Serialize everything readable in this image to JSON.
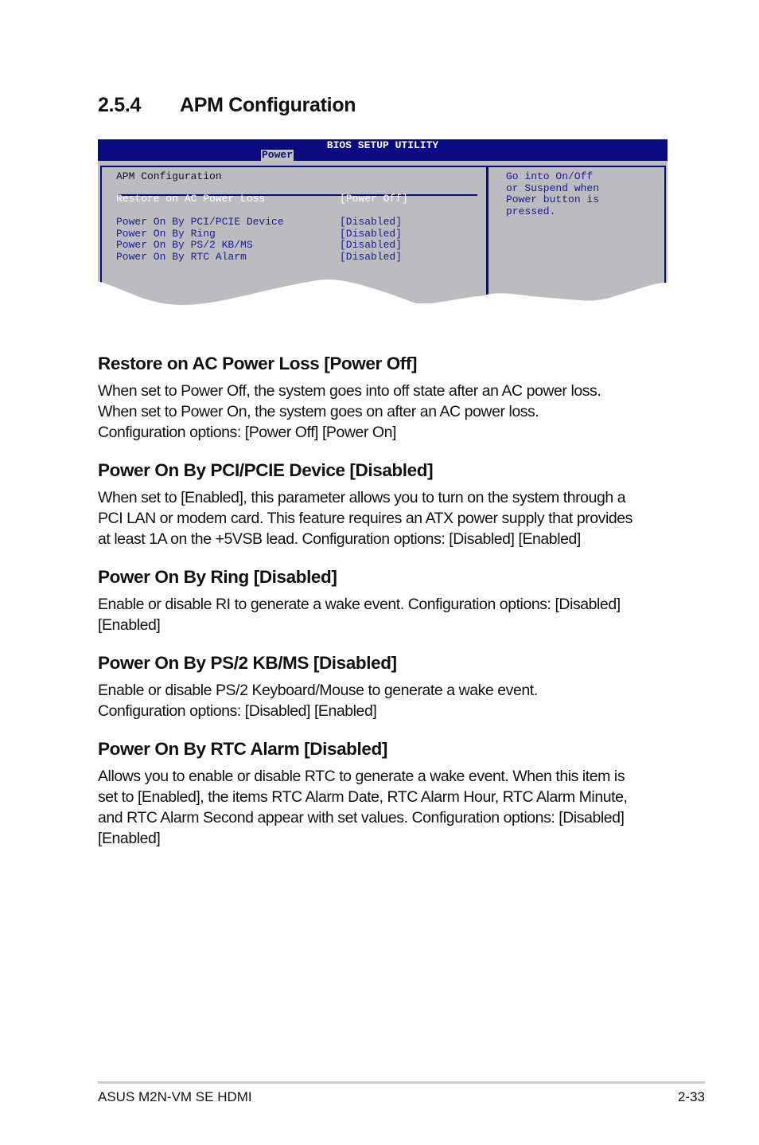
{
  "section": {
    "number": "2.5.4",
    "title": "APM Configuration"
  },
  "bios": {
    "title": "BIOS SETUP UTILITY",
    "tab": "Power",
    "panel_title": "APM Configuration",
    "items": [
      {
        "label": "Restore on AC Power Loss",
        "value": "[Power Off]",
        "selected": true
      },
      {
        "label": "Power On By PCI/PCIE Device",
        "value": "[Disabled]"
      },
      {
        "label": "Power On By Ring",
        "value": "[Disabled]"
      },
      {
        "label": "Power On By PS/2 KB/MS",
        "value": "[Disabled]"
      },
      {
        "label": "Power On By RTC Alarm",
        "value": "[Disabled]"
      }
    ],
    "help": [
      "Go into On/Off",
      "or Suspend when",
      "Power button is",
      "pressed."
    ],
    "colors": {
      "bar": "#0a0a80",
      "panel": "#bcbcc0",
      "selected_text": "#ffffff"
    }
  },
  "sections": [
    {
      "heading": "Restore on AC Power Loss [Power Off]",
      "lines": [
        "When set to Power Off, the system goes into off state after an AC power loss.",
        "When set to Power On, the system goes on after an AC power loss.",
        "Configuration options: [Power Off] [Power On]"
      ]
    },
    {
      "heading": "Power On By PCI/PCIE Device [Disabled]",
      "lines": [
        "When set to [Enabled], this parameter allows you to turn on the system through a",
        "PCI LAN or modem card. This feature requires an ATX power supply that provides",
        "at least 1A on the +5VSB lead. Configuration options: [Disabled] [Enabled]"
      ]
    },
    {
      "heading": "Power On By Ring [Disabled]",
      "lines": [
        "Enable or disable RI to generate a wake event. Configuration options: [Disabled]",
        "[Enabled]"
      ]
    },
    {
      "heading": "Power On By PS/2 KB/MS [Disabled]",
      "lines": [
        "Enable or disable PS/2 Keyboard/Mouse to generate a wake event.",
        "Configuration options: [Disabled] [Enabled]"
      ]
    },
    {
      "heading": "Power On By RTC Alarm [Disabled]",
      "lines": [
        "Allows you to enable or disable RTC to generate a wake event. When this item is",
        "set to [Enabled], the items RTC Alarm Date, RTC Alarm Hour, RTC Alarm Minute,",
        "and RTC Alarm Second appear with set values. Configuration options: [Disabled]",
        "[Enabled]"
      ]
    }
  ],
  "footer": {
    "left": "ASUS M2N-VM SE HDMI",
    "right": "2-33"
  }
}
